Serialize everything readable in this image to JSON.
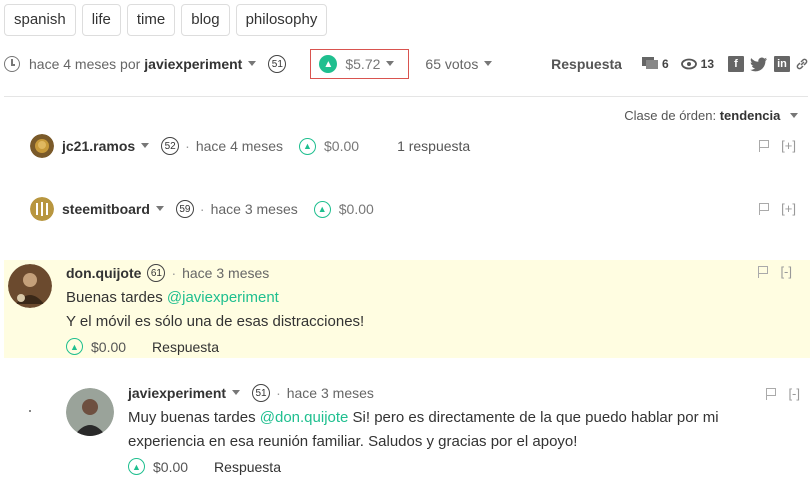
{
  "tags": [
    "spanish",
    "life",
    "time",
    "blog",
    "philosophy"
  ],
  "post": {
    "time_prefix": "hace 4 meses por",
    "author": "javiexperiment",
    "reputation": "51",
    "payout": "$5.72",
    "votes": "65 votos",
    "reply_label": "Respuesta",
    "comments_count": "6",
    "views_count": "13"
  },
  "sort": {
    "label": "Clase de órden:",
    "value": "tendencia"
  },
  "comments": [
    {
      "author": "jc21.ramos",
      "reputation": "52",
      "time": "hace 4 meses",
      "payout": "$0.00",
      "replies": "1 respuesta",
      "toggle": "[+]"
    },
    {
      "author": "steemitboard",
      "reputation": "59",
      "time": "hace 3 meses",
      "payout": "$0.00",
      "toggle": "[+]"
    },
    {
      "author": "don.quijote",
      "reputation": "61",
      "time": "hace 3 meses",
      "line1_text": "Buenas tardes ",
      "line1_mention": "@javiexperiment",
      "line2": "Y el móvil es sólo una de esas distracciones!",
      "payout": "$0.00",
      "reply_label": "Respuesta",
      "toggle": "[-]"
    },
    {
      "author": "javiexperiment",
      "reputation": "51",
      "time": "hace 3 meses",
      "line1_text": "Muy buenas tardes ",
      "line1_mention": "@don.quijote",
      "line1_rest": " Si! pero es directamente de la que puedo hablar por mi",
      "line2": "experiencia en esa reunión familiar. Saludos y gracias por el apoyo!",
      "payout": "$0.00",
      "reply_label": "Respuesta",
      "toggle": "[-]"
    }
  ],
  "colors": {
    "accent": "#1fbf8f",
    "highlight": "#fffde1",
    "vote_border": "#d9534f"
  }
}
